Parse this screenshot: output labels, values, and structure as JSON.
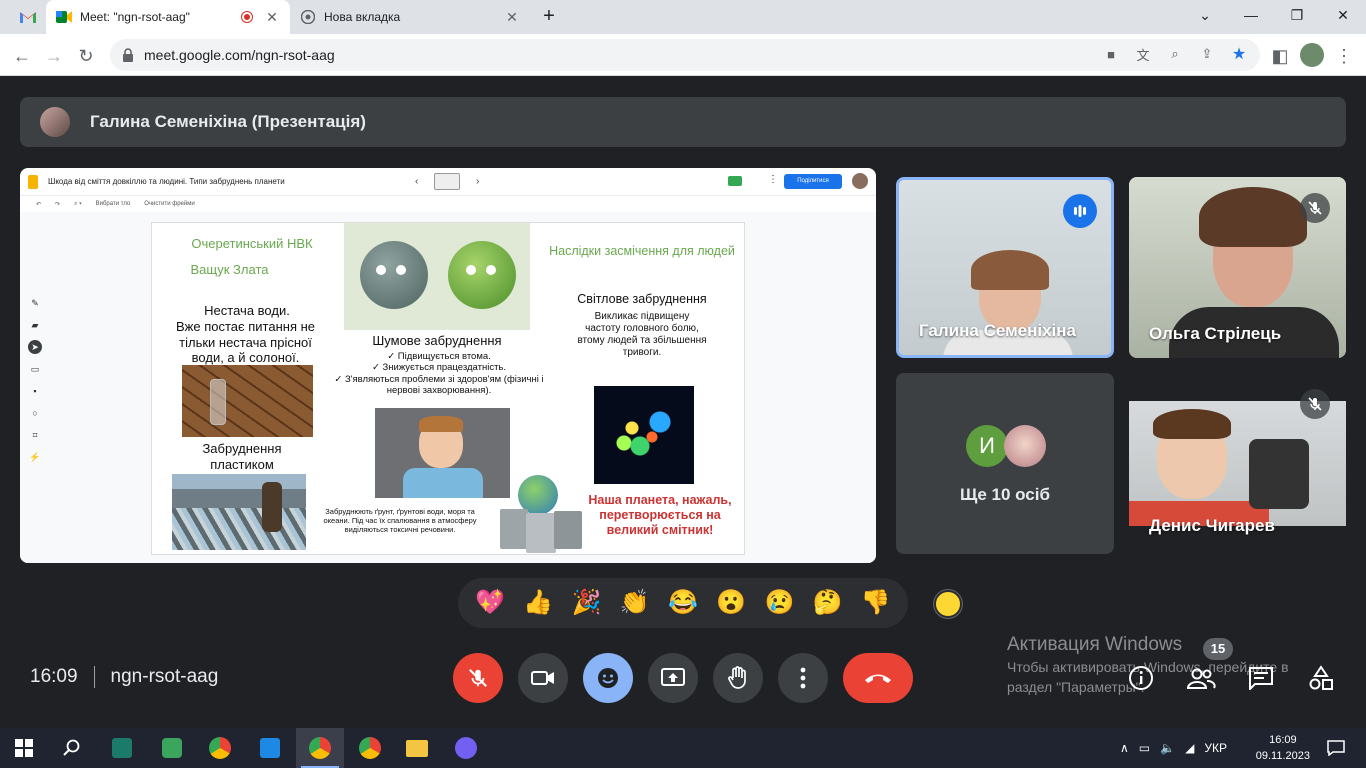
{
  "browser": {
    "tabs": [
      {
        "title": "Meet: \"ngn-rsot-aag\""
      },
      {
        "title": "Нова вкладка"
      }
    ],
    "url": "meet.google.com/ngn-rsot-aag"
  },
  "meet": {
    "presenter_label": "Галина Семеніхіна (Презентація)",
    "time": "16:09",
    "meeting_code": "ngn-rsot-aag",
    "participant_count": "15",
    "others_label": "Ще 10 осіб",
    "others_initial": "И",
    "participants": [
      {
        "name": "Галина Семеніхіна"
      },
      {
        "name": "Ольга Стрілець"
      },
      {
        "name": "Денис Чигарев"
      }
    ],
    "reactions": [
      "💖",
      "👍",
      "🎉",
      "👏",
      "😂",
      "😮",
      "😢",
      "🤔",
      "👎"
    ]
  },
  "slides_app": {
    "doc_title": "Шкода від сміття довкіллю та людині. Типи забруднень планети",
    "share_label": "Поділитися",
    "tool_select": "Вибрати тло",
    "tool_clear": "Очистити фрейми"
  },
  "slide": {
    "school": "Очеретинський НВК",
    "author": "Ващук Злата",
    "water_title": "Нестача води.",
    "water_text": "Вже постає питання не тільки нестача прісної води, а й солоної.",
    "plastic_title": "Забруднення пластиком",
    "noise_title": "Шумове забруднення",
    "noise_items": [
      "✓ Підвищується втома.",
      "✓ Знижується працездатність.",
      "✓ З'являються  проблеми зі здоров'ям (фізичні і нервові захворювання)."
    ],
    "soil_text": "Забруднюють ґрунт, ґрунтові води, моря та океани. Під час їх спалювання в атмосферу виділяються токсичні речовини.",
    "consequences_title": "Наслідки засмічення для людей",
    "light_title": "Світлове забруднення",
    "light_text": "Викликає підвищену частоту головного болю, втому людей та збільшення тривоги.",
    "conclusion": "Наша планета, нажаль, перетворюється на великий смітник!"
  },
  "watermark": {
    "title": "Активация Windows",
    "text": "Чтобы активировать Windows, перейдите в раздел \"Параметры\"."
  },
  "taskbar": {
    "lang": "УКР",
    "time": "16:09",
    "date": "09.11.2023"
  },
  "colors": {
    "meet_bg": "#202124",
    "tile_bg": "#3c4043",
    "end_call_red": "#ea4335",
    "active_blue": "#8ab4f8",
    "speaking_blue": "#1a73e8",
    "slide_green": "#6aa84f",
    "slide_red": "#cc3333"
  }
}
